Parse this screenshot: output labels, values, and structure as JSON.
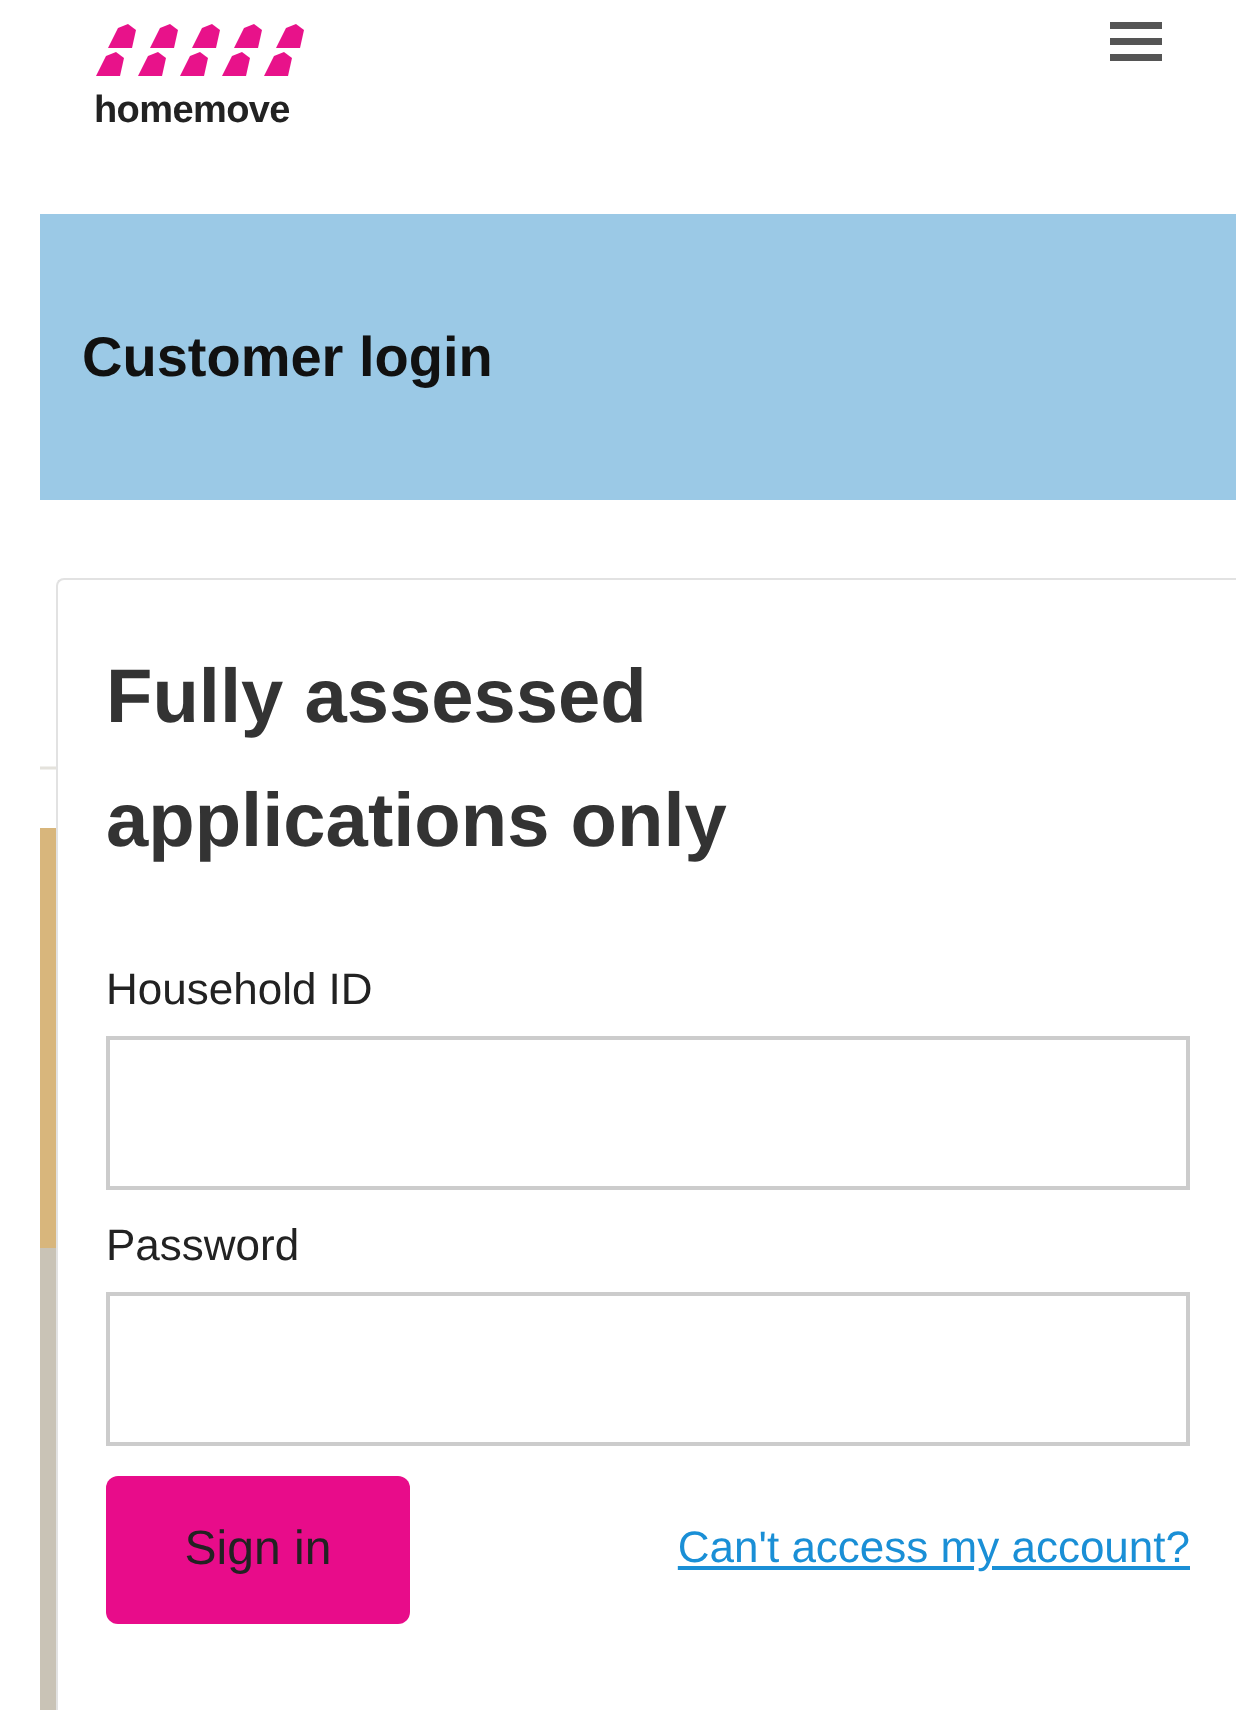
{
  "header": {
    "logo_text": "homemove"
  },
  "banner": {
    "title": "Customer login"
  },
  "login_card": {
    "heading": "Fully assessed applications only",
    "fields": [
      {
        "label": "Household ID"
      },
      {
        "label": "Password"
      }
    ],
    "submit": "Sign in",
    "help_link": "Can't access my account?"
  }
}
